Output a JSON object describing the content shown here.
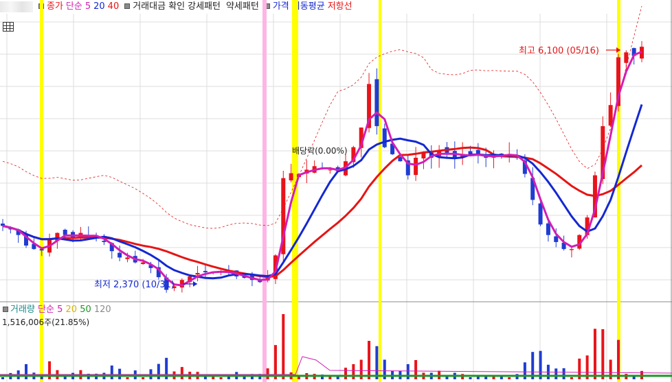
{
  "legend": {
    "close_label": "종가",
    "ma_label": "단순",
    "ma5": "5",
    "ma20": "20",
    "ma40": "40",
    "trade_label": "거래대금 확인",
    "strong_label": "강세패턴",
    "weak_label": "약세패턴",
    "envelope_label": "가격 이동평균",
    "resistance_label": "저항선"
  },
  "volume_legend": {
    "title": "거래량",
    "ma_label": "단순",
    "p5": "5",
    "p20": "20",
    "p50": "50",
    "p120": "120",
    "info": "1,516,006주(21.85%)"
  },
  "annotations": {
    "high": "최고 6,100 (05/16)",
    "low": "최저 2,370 (10/31)",
    "dividend": "배당락(0.00%)"
  },
  "colors": {
    "up": "#e8141a",
    "down": "#1f3cd2",
    "ma5": "#d21eb4",
    "ma20": "#1428d2",
    "ma40": "#e61414",
    "envelope": "#e61414",
    "strong_highlight": "#ffff00",
    "weak_highlight": "#ffb4e6",
    "grid": "#dcdcdc"
  },
  "chart_data": {
    "type": "candlestick",
    "price_range_estimated": [
      2200,
      6300
    ],
    "high": {
      "value": 6100,
      "date": "05/16"
    },
    "low": {
      "value": 2370,
      "date": "10/31"
    },
    "strong_pattern_marks": 5,
    "weak_pattern_marks": 1,
    "close_estimated": [
      3280,
      3230,
      3150,
      3000,
      2950,
      2930,
      3100,
      3180,
      3150,
      3100,
      3180,
      3140,
      3100,
      3050,
      2920,
      2830,
      2830,
      2760,
      2760,
      2680,
      2550,
      2370,
      2420,
      2510,
      2560,
      2610,
      2620,
      2630,
      2630,
      2610,
      2560,
      2540,
      2510,
      2480,
      2560,
      2860,
      3960,
      4030,
      4020,
      4080,
      4130,
      4090,
      4080,
      4060,
      4200,
      4400,
      4680,
      5300,
      4700,
      4400,
      4300,
      4200,
      4000,
      4250,
      4320,
      4250,
      4350,
      4320,
      4250,
      4300,
      4300,
      4280,
      4250,
      4280,
      4300,
      4300,
      4250,
      4020,
      3650,
      3300,
      3150,
      3050,
      2950,
      2950,
      3150,
      3400,
      4000,
      4700,
      5000,
      5680,
      5750,
      5700,
      5830
    ]
  }
}
